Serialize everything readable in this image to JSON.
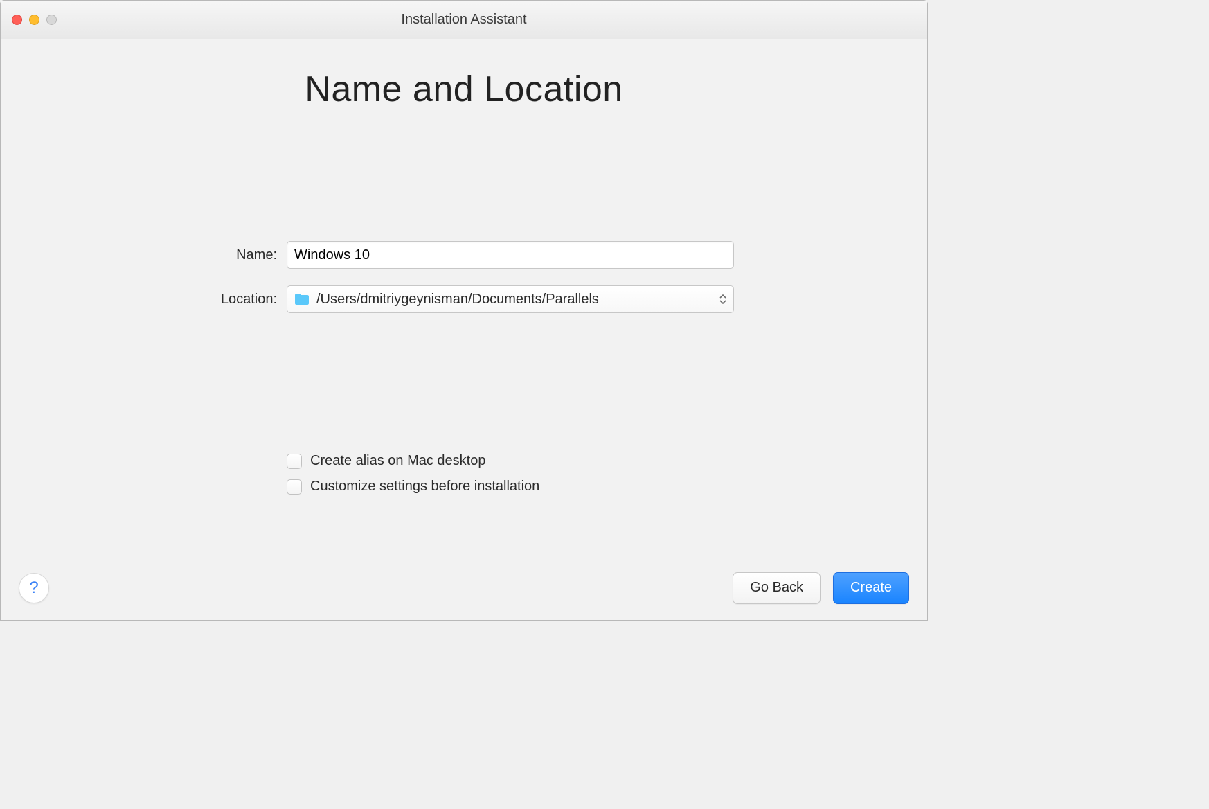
{
  "window": {
    "title": "Installation Assistant"
  },
  "heading": "Name and Location",
  "form": {
    "name_label": "Name:",
    "name_value": "Windows 10",
    "location_label": "Location:",
    "location_value": "/Users/dmitriygeynisman/Documents/Parallels"
  },
  "options": {
    "create_alias": "Create alias on Mac desktop",
    "customize": "Customize settings before installation"
  },
  "footer": {
    "help": "?",
    "go_back": "Go Back",
    "create": "Create"
  }
}
